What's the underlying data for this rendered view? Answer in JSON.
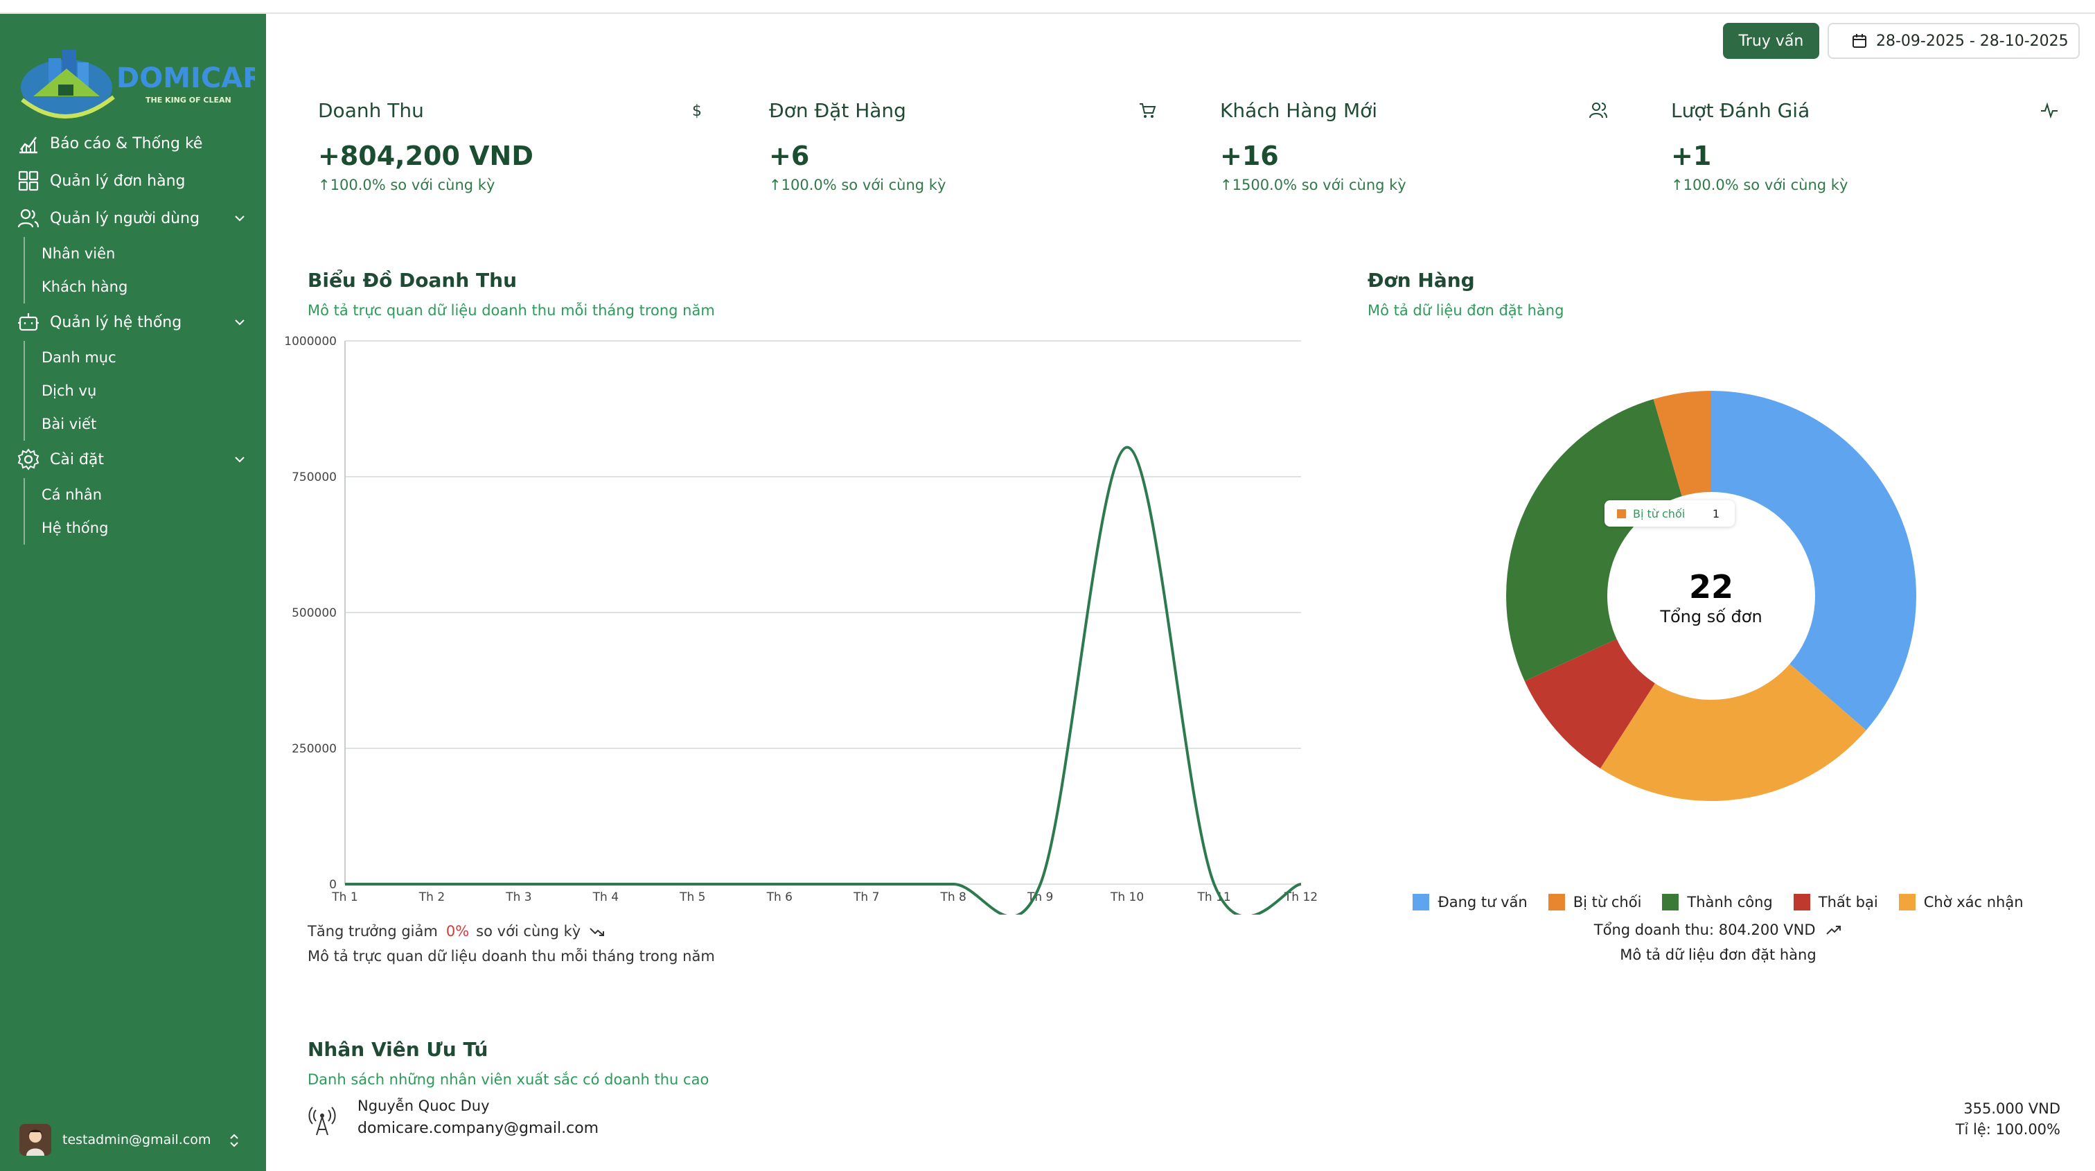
{
  "brand": {
    "logo_text": "DOMICARE",
    "tagline": "THE KING OF CLEAN"
  },
  "sidebar": {
    "items": [
      {
        "label": "Báo cáo & Thống kê",
        "icon": "chart-line-icon"
      },
      {
        "label": "Quản lý đơn hàng",
        "icon": "grid-icon"
      },
      {
        "label": "Quản lý người dùng",
        "icon": "users-icon",
        "children": [
          "Nhân viên",
          "Khách hàng"
        ]
      },
      {
        "label": "Quản lý hệ thống",
        "icon": "robot-icon",
        "children": [
          "Danh mục",
          "Dịch vụ",
          "Bài viết"
        ]
      },
      {
        "label": "Cài đặt",
        "icon": "gear-icon",
        "children": [
          "Cá nhân",
          "Hệ thống"
        ]
      }
    ],
    "user_email": "testadmin@gmail.com"
  },
  "header": {
    "query_button": "Truy vấn",
    "date_range": "28-09-2025 - 28-10-2025"
  },
  "stats": [
    {
      "title": "Doanh Thu",
      "value": "+804,200 VND",
      "change": "100.0% so với cùng kỳ",
      "icon": "dollar-icon"
    },
    {
      "title": "Đơn Đặt Hàng",
      "value": "+6",
      "change": "100.0% so với cùng kỳ",
      "icon": "cart-icon"
    },
    {
      "title": "Khách Hàng Mới",
      "value": "+16",
      "change": "1500.0% so với cùng kỳ",
      "icon": "users-icon"
    },
    {
      "title": "Lượt Đánh Giá",
      "value": "+1",
      "change": "100.0% so với cùng kỳ",
      "icon": "activity-icon"
    }
  ],
  "revenue": {
    "title": "Biểu Đồ Doanh Thu",
    "description": "Mô tả trực quan dữ liệu doanh thu mỗi tháng trong năm",
    "trend_text": "Tăng trưởng giảm",
    "trend_pct": "0%",
    "trend_suffix": "so với cùng kỳ",
    "footer_note": "Mô tả trực quan dữ liệu doanh thu mỗi tháng trong năm"
  },
  "orders": {
    "title": "Đơn Hàng",
    "description": "Mô tả dữ liệu đơn đặt hàng",
    "total": "22",
    "total_label": "Tổng số đơn",
    "tooltip_label": "Bị từ chối",
    "tooltip_value": "1",
    "total_revenue": "Tổng doanh thu: 804.200 VND",
    "footer_note": "Mô tả dữ liệu đơn đặt hàng"
  },
  "employees": {
    "title": "Nhân Viên Ưu Tú",
    "description": "Danh sách những nhân viên xuất sắc có doanh thu cao",
    "list": [
      {
        "name": "Nguyễn Quoc Duy",
        "email": "domicare.company@gmail.com",
        "amount": "355.000 VND",
        "rate": "Tỉ lệ: 100.00%"
      }
    ]
  },
  "colors": {
    "sidebar": "#2e7a49",
    "accent": "#2e7a49",
    "line": "#2e7a4f"
  },
  "chart_data": [
    {
      "type": "line",
      "categories": [
        "Th 1",
        "Th 2",
        "Th 3",
        "Th 4",
        "Th 5",
        "Th 6",
        "Th 7",
        "Th 8",
        "Th 9",
        "Th 10",
        "Th 11",
        "Th 12"
      ],
      "series": [
        {
          "values": [
            0,
            0,
            0,
            0,
            0,
            0,
            0,
            0,
            0,
            804200,
            0,
            0
          ]
        }
      ],
      "ylim": [
        0,
        1000000
      ],
      "yticks": [
        0,
        250000,
        500000,
        750000,
        1000000
      ],
      "grid": true
    },
    {
      "type": "pie",
      "donut": true,
      "slices": [
        {
          "label": "Đang tư vấn",
          "value": 8,
          "color": "#5ea4ee"
        },
        {
          "label": "Chờ xác nhận",
          "value": 5,
          "color": "#f2a53a"
        },
        {
          "label": "Thất bại",
          "value": 2,
          "color": "#c0392f"
        },
        {
          "label": "Thành công",
          "value": 6,
          "color": "#3b7a36"
        },
        {
          "label": "Bị từ chối",
          "value": 1,
          "color": "#e8852f"
        }
      ],
      "legend_order": [
        "Đang tư vấn",
        "Bị từ chối",
        "Thành công",
        "Thất bại",
        "Chờ xác nhận"
      ],
      "legend": "bottom"
    }
  ]
}
